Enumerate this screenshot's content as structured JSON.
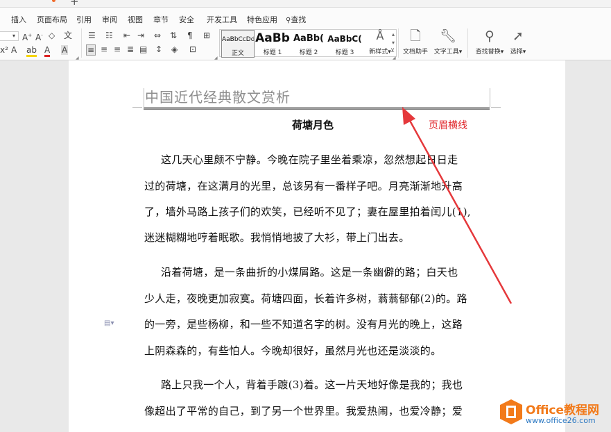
{
  "menu": {
    "items": [
      "插入",
      "页面布局",
      "引用",
      "审阅",
      "视图",
      "章节",
      "安全",
      "开发工具",
      "特色应用",
      "查找"
    ]
  },
  "toolbar": {
    "styles": [
      {
        "preview": "AaBbCcDd",
        "name": "正文"
      },
      {
        "preview": "AaBb",
        "name": "标题 1"
      },
      {
        "preview": "AaBb(",
        "name": "标题 2"
      },
      {
        "preview": "AaBbC(",
        "name": "标题 3"
      }
    ],
    "new_style": "新样式",
    "doc_assistant": "文档助手",
    "text_tools": "文字工具",
    "find_replace": "查找替换",
    "select": "选择"
  },
  "document": {
    "header_text": "中国近代经典散文赏析",
    "title": "荷塘月色",
    "lines": [
      "这几天心里颇不宁静。今晚在院子里坐着乘凉，忽然想起日日走",
      "过的荷塘，在这满月的光里，总该另有一番样子吧。月亮渐渐地升高",
      "了，墙外马路上孩子们的欢笑，已经听不见了；妻在屋里拍着闰儿(1),",
      "迷迷糊糊地哼着眠歌。我悄悄地披了大衫，带上门出去。",
      "沿着荷塘，是一条曲折的小煤屑路。这是一条幽僻的路；白天也",
      "少人走，夜晚更加寂寞。荷塘四面，长着许多树，蓊蓊郁郁(2)的。路",
      "的一旁，是些杨柳，和一些不知道名字的树。没有月光的晚上，这路",
      "上阴森森的，有些怕人。今晚却很好，虽然月光也还是淡淡的。",
      "路上只我一个人，背着手踱(3)着。这一片天地好像是我的；我也",
      "像超出了平常的自己，到了另一个世界里。我爱热闹，也爱冷静；爱"
    ]
  },
  "annotation": {
    "label": "页眉横线",
    "color": "#e0262b"
  },
  "watermark": {
    "brand": "Office教程网",
    "url": "www.office26.com"
  },
  "colors": {
    "accent": "#e0262b",
    "brand_orange": "#f27a1a",
    "brand_blue": "#2b78c2"
  }
}
